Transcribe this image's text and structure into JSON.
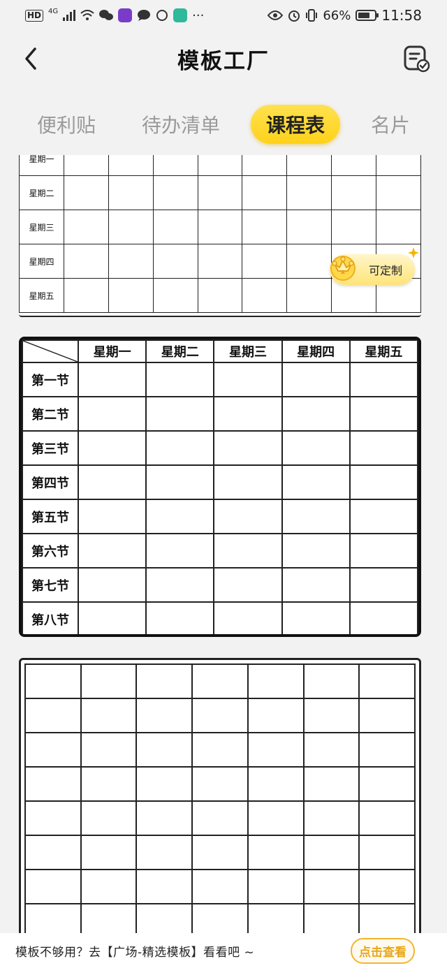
{
  "status_bar": {
    "hd": "HD",
    "network": "4G",
    "battery": "66%",
    "time": "11:58",
    "more": "···"
  },
  "header": {
    "title": "模板工厂"
  },
  "tabs": [
    {
      "label": "便利贴"
    },
    {
      "label": "待办清单"
    },
    {
      "label": "课程表"
    },
    {
      "label": "名片"
    }
  ],
  "template1": {
    "rows": [
      "星期一",
      "星期二",
      "星期三",
      "星期四",
      "星期五"
    ],
    "badge": "可定制"
  },
  "template2": {
    "columns": [
      "星期一",
      "星期二",
      "星期三",
      "星期四",
      "星期五"
    ],
    "rows": [
      "第一节",
      "第二节",
      "第三节",
      "第四节",
      "第五节",
      "第六节",
      "第七节",
      "第八节"
    ]
  },
  "bottom": {
    "text": "模板不够用？去【广场-精选模板】看看吧 ~",
    "button": "点击查看"
  },
  "colors": {
    "accent": "#ffd21a",
    "button_orange": "#f3b52d"
  }
}
